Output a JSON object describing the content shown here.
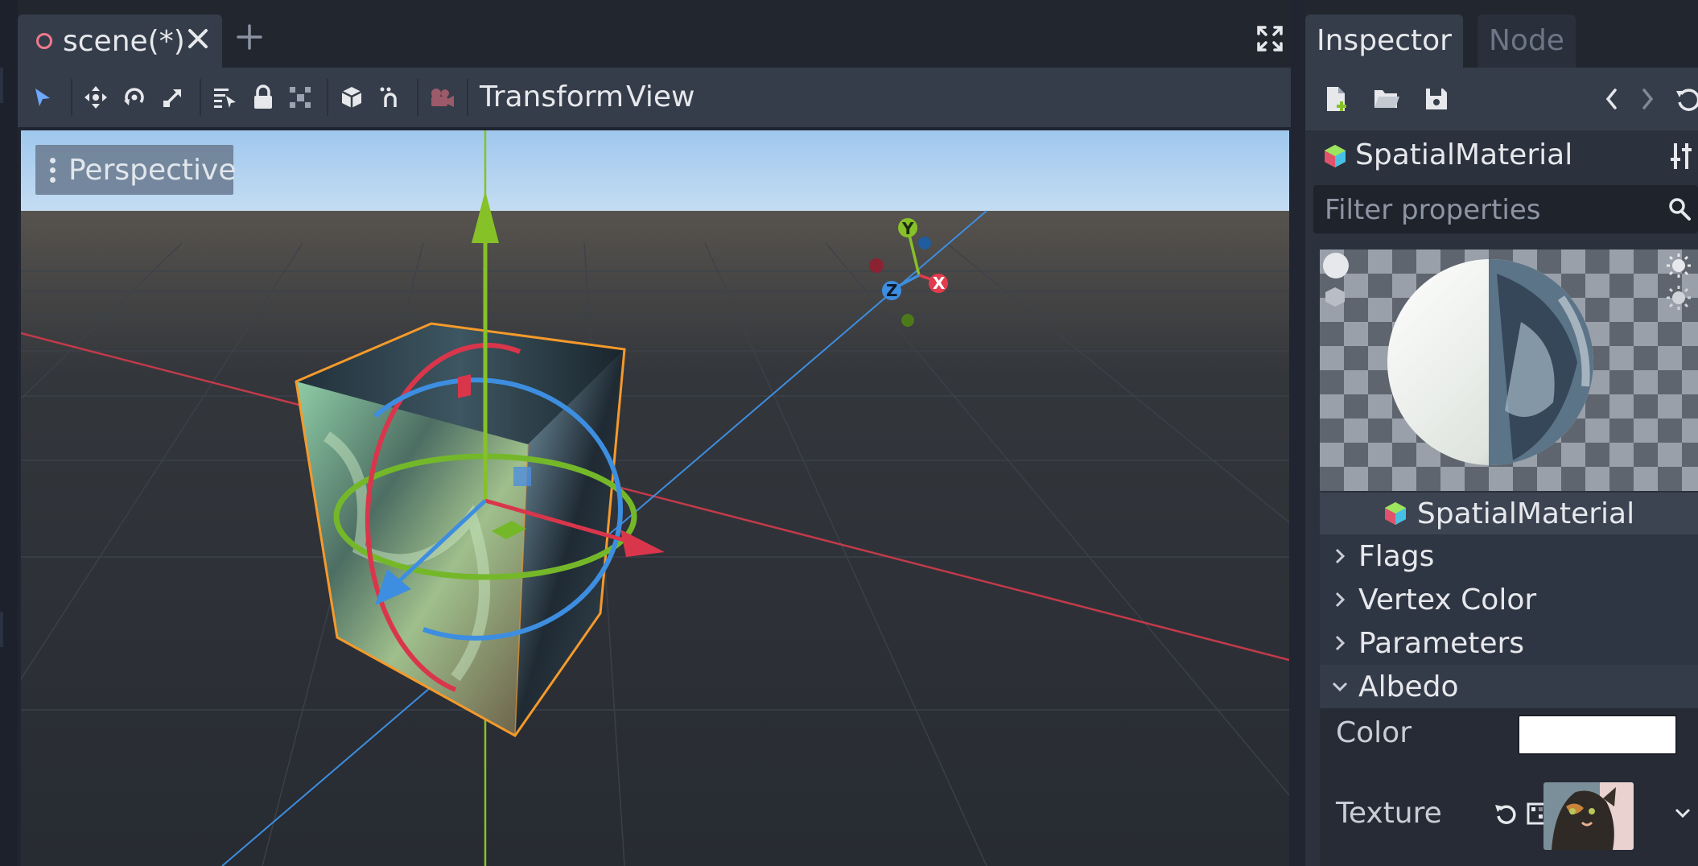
{
  "editor_tabs": {
    "scene_tab_label": "scene(*)"
  },
  "viewport_toolbar": {
    "menus": [
      "Transform",
      "View"
    ]
  },
  "viewport": {
    "view_mode_label": "Perspective",
    "gizmo_axes": [
      "Y",
      "X",
      "Z"
    ],
    "colors": {
      "x_axis": "#e33b4e",
      "y_axis": "#87c128",
      "z_axis": "#3d8ee0",
      "selection_outline": "#f59a2b",
      "sky_top": "#9fc8ee",
      "ground": "#2a2e35"
    }
  },
  "inspector": {
    "tabs": [
      "Inspector",
      "Node"
    ],
    "resource_type": "SpatialMaterial",
    "filter_placeholder": "Filter properties",
    "material_header": "SpatialMaterial",
    "sections": [
      {
        "label": "Flags",
        "expanded": false
      },
      {
        "label": "Vertex Color",
        "expanded": false
      },
      {
        "label": "Parameters",
        "expanded": false
      },
      {
        "label": "Albedo",
        "expanded": true
      }
    ],
    "albedo": {
      "color_label": "Color",
      "color_value": "#ffffff",
      "texture_label": "Texture"
    }
  }
}
